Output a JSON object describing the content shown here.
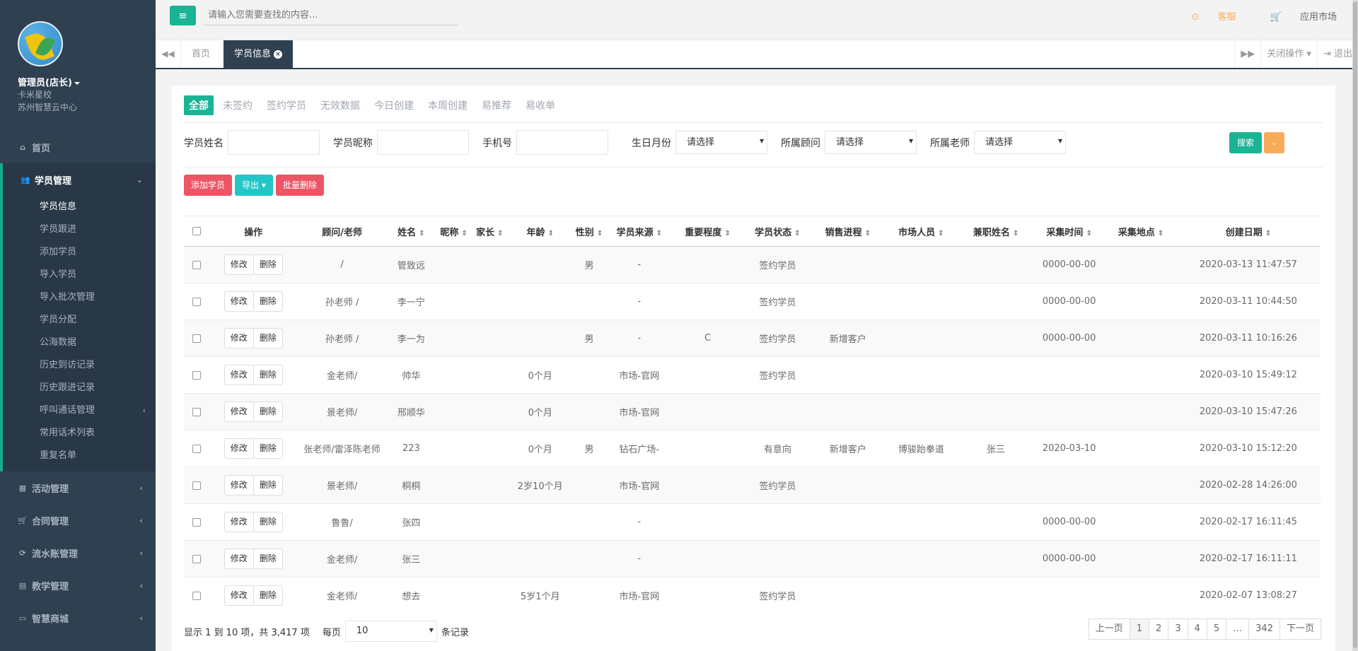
{
  "profile": {
    "name": "管理员(店长)",
    "school": "卡米星校",
    "org": "苏州智慧云中心"
  },
  "sidebar": {
    "items": [
      {
        "icon": "home-icon",
        "label": "首页"
      },
      {
        "icon": "users-icon",
        "label": "学员管理"
      },
      {
        "icon": "map-icon",
        "label": "活动管理"
      },
      {
        "icon": "cart-icon",
        "label": "合同管理"
      },
      {
        "icon": "refresh-icon",
        "label": "流水账管理"
      },
      {
        "icon": "calendar-icon",
        "label": "教学管理"
      },
      {
        "icon": "inbox-icon",
        "label": "智慧商城"
      }
    ],
    "submenu": [
      "学员信息",
      "学员跟进",
      "添加学员",
      "导入学员",
      "导入批次管理",
      "学员分配",
      "公海数据",
      "历史到访记录",
      "历史跟进记录",
      "呼叫通话管理",
      "常用话术列表",
      "重复名单"
    ]
  },
  "topbar": {
    "search_placeholder": "请输入您需要查找的内容...",
    "kefu": "客服",
    "app_market": "应用市场"
  },
  "tabs": {
    "home": "首页",
    "current": "学员信息",
    "close_ops": "关闭操作",
    "logout": "退出"
  },
  "filters": [
    "全部",
    "未签约",
    "签约学员",
    "无效数据",
    "今日创建",
    "本周创建",
    "易推荐",
    "易收单"
  ],
  "form": {
    "name_label": "学员姓名",
    "nick_label": "学员昵称",
    "phone_label": "手机号",
    "birth_label": "生日月份",
    "advisor_label": "所属顾问",
    "teacher_label": "所属老师",
    "select_placeholder": "请选择",
    "search_btn": "搜索"
  },
  "actions": {
    "add": "添加学员",
    "export": "导出",
    "batch_delete": "批量删除"
  },
  "table": {
    "headers": [
      "操作",
      "顾问/老师",
      "姓名",
      "昵称",
      "家长",
      "年龄",
      "性别",
      "学员来源",
      "重要程度",
      "学员状态",
      "销售进程",
      "市场人员",
      "兼职姓名",
      "采集时间",
      "采集地点",
      "创建日期"
    ],
    "edit_label": "修改",
    "delete_label": "删除",
    "rows": [
      {
        "advisor": "/",
        "name": "管致远",
        "nick": "",
        "parent": "",
        "age": "",
        "gender": "男",
        "source": "-",
        "importance": "",
        "status": "签约学员",
        "sales": "",
        "market": "",
        "parttime": "",
        "collect_time": "0000-00-00",
        "collect_place": "",
        "created": "2020-03-13 11:47:57"
      },
      {
        "advisor": "孙老师 /",
        "name": "李一宁",
        "nick": "",
        "parent": "",
        "age": "",
        "gender": "",
        "source": "-",
        "importance": "",
        "status": "签约学员",
        "sales": "",
        "market": "",
        "parttime": "",
        "collect_time": "0000-00-00",
        "collect_place": "",
        "created": "2020-03-11 10:44:50"
      },
      {
        "advisor": "孙老师 /",
        "name": "李一为",
        "nick": "",
        "parent": "",
        "age": "",
        "gender": "男",
        "source": "-",
        "importance": "C",
        "status": "签约学员",
        "sales": "新增客户",
        "market": "",
        "parttime": "",
        "collect_time": "0000-00-00",
        "collect_place": "",
        "created": "2020-03-11 10:16:26"
      },
      {
        "advisor": "金老师/",
        "name": "帅华",
        "nick": "",
        "parent": "",
        "age": "0个月",
        "gender": "",
        "source": "市场-官网",
        "importance": "",
        "status": "签约学员",
        "sales": "",
        "market": "",
        "parttime": "",
        "collect_time": "",
        "collect_place": "",
        "created": "2020-03-10 15:49:12"
      },
      {
        "advisor": "景老师/",
        "name": "邢顺华",
        "nick": "",
        "parent": "",
        "age": "0个月",
        "gender": "",
        "source": "市场-官网",
        "importance": "",
        "status": "",
        "sales": "",
        "market": "",
        "parttime": "",
        "collect_time": "",
        "collect_place": "",
        "created": "2020-03-10 15:47:26"
      },
      {
        "advisor": "张老师/雷泽陈老师",
        "name": "223",
        "nick": "",
        "parent": "",
        "age": "0个月",
        "gender": "男",
        "source": "钻石广场-",
        "importance": "",
        "status": "有意向",
        "sales": "新增客户",
        "market": "博骏跆拳道",
        "parttime": "张三",
        "collect_time": "2020-03-10",
        "collect_place": "",
        "created": "2020-03-10 15:12:20"
      },
      {
        "advisor": "景老师/",
        "name": "桐桐",
        "nick": "",
        "parent": "",
        "age": "2岁10个月",
        "gender": "",
        "source": "市场-官网",
        "importance": "",
        "status": "签约学员",
        "sales": "",
        "market": "",
        "parttime": "",
        "collect_time": "",
        "collect_place": "",
        "created": "2020-02-28 14:26:00"
      },
      {
        "advisor": "鲁鲁/",
        "name": "张四",
        "nick": "",
        "parent": "",
        "age": "",
        "gender": "",
        "source": "-",
        "importance": "",
        "status": "",
        "sales": "",
        "market": "",
        "parttime": "",
        "collect_time": "0000-00-00",
        "collect_place": "",
        "created": "2020-02-17 16:11:45"
      },
      {
        "advisor": "金老师/",
        "name": "张三",
        "nick": "",
        "parent": "",
        "age": "",
        "gender": "",
        "source": "-",
        "importance": "",
        "status": "",
        "sales": "",
        "market": "",
        "parttime": "",
        "collect_time": "0000-00-00",
        "collect_place": "",
        "created": "2020-02-17 16:11:11"
      },
      {
        "advisor": "金老师/",
        "name": "想去",
        "nick": "",
        "parent": "",
        "age": "5岁1个月",
        "gender": "",
        "source": "市场-官网",
        "importance": "",
        "status": "签约学员",
        "sales": "",
        "market": "",
        "parttime": "",
        "collect_time": "",
        "collect_place": "",
        "created": "2020-02-07 13:08:27"
      }
    ]
  },
  "footer": {
    "info": "显示 1 到 10 项，共 3,417 项",
    "per_page_label": "每页",
    "per_page_value": "10",
    "records_label": "条记录",
    "pages": [
      "上一页",
      "1",
      "2",
      "3",
      "4",
      "5",
      "…",
      "342",
      "下一页"
    ]
  }
}
